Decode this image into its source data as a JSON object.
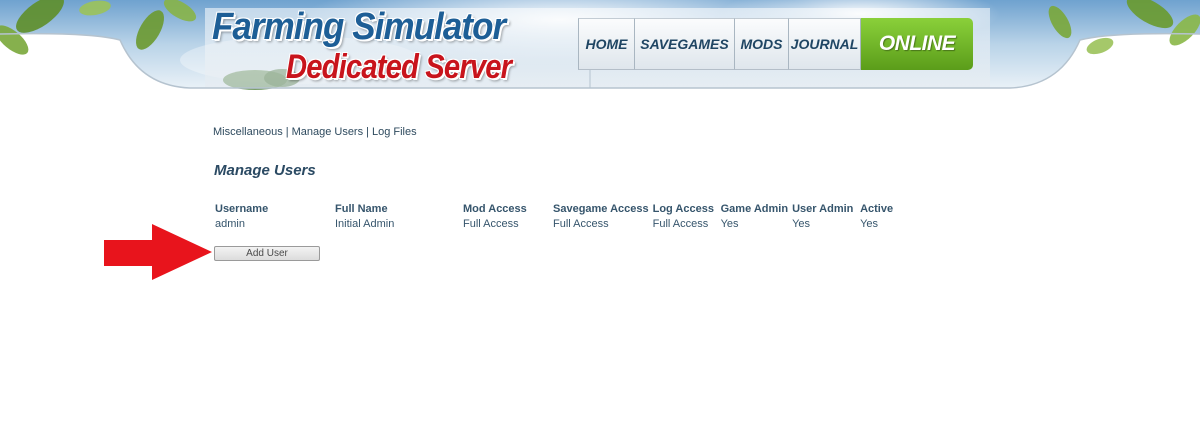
{
  "header": {
    "logo_line1": "Farming Simulator",
    "logo_line2": "Dedicated Server"
  },
  "nav": {
    "home": "HOME",
    "savegames": "SAVEGAMES",
    "mods": "MODS",
    "journal": "JOURNAL",
    "online": "ONLINE"
  },
  "subnav": {
    "items": [
      "Miscellaneous",
      "Manage Users",
      "Log Files"
    ],
    "separator": "|"
  },
  "page": {
    "title": "Manage Users"
  },
  "users_table": {
    "columns": [
      "Username",
      "Full Name",
      "Mod Access",
      "Savegame Access",
      "Log Access",
      "Game Admin",
      "User Admin",
      "Active"
    ],
    "rows": [
      [
        "admin",
        "Initial Admin",
        "Full Access",
        "Full Access",
        "Full Access",
        "Yes",
        "Yes",
        "Yes"
      ]
    ]
  },
  "actions": {
    "add_user_label": "Add User"
  },
  "colors": {
    "accent_blue": "#1d5e96",
    "logo_red": "#c8141c",
    "online_green": "#6cb026",
    "annotation_arrow": "#e8141c"
  }
}
